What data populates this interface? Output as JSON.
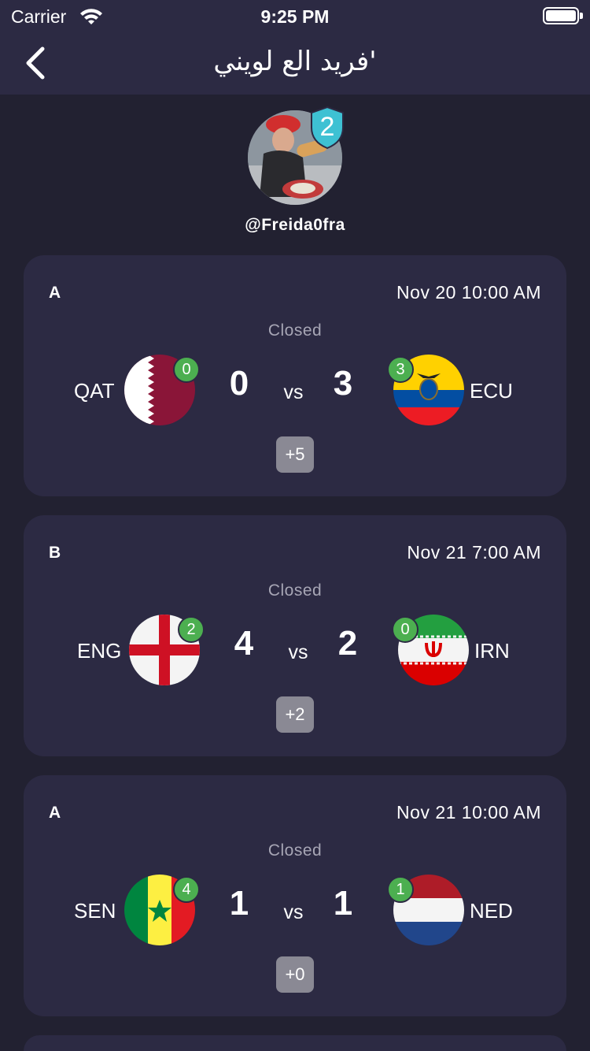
{
  "status_bar": {
    "carrier": "Carrier",
    "time": "9:25 PM"
  },
  "nav": {
    "title": "فريد الع لويني'",
    "back_icon": "chevron-left-icon"
  },
  "profile": {
    "rank": "2",
    "username": "@Freida0fra"
  },
  "colors": {
    "background": "#222131",
    "card": "#2c2a43",
    "badge_green": "#4caf50",
    "rank_badge": "#3ec1d3",
    "more_button": "#8a8994"
  },
  "matches": [
    {
      "group": "A",
      "date": "Nov 20 10:00 AM",
      "state": "Closed",
      "home": {
        "code": "QAT",
        "flag": "qatar-flag",
        "prediction": "0",
        "score": "0"
      },
      "vs": "vs",
      "away": {
        "code": "ECU",
        "flag": "ecuador-flag",
        "prediction": "3",
        "score": "3"
      },
      "more": "+5"
    },
    {
      "group": "B",
      "date": "Nov 21 7:00 AM",
      "state": "Closed",
      "home": {
        "code": "ENG",
        "flag": "england-flag",
        "prediction": "2",
        "score": "4"
      },
      "vs": "vs",
      "away": {
        "code": "IRN",
        "flag": "iran-flag",
        "prediction": "0",
        "score": "2"
      },
      "more": "+2"
    },
    {
      "group": "A",
      "date": "Nov 21 10:00 AM",
      "state": "Closed",
      "home": {
        "code": "SEN",
        "flag": "senegal-flag",
        "prediction": "4",
        "score": "1"
      },
      "vs": "vs",
      "away": {
        "code": "NED",
        "flag": "netherlands-flag",
        "prediction": "1",
        "score": "1"
      },
      "more": "+0"
    }
  ]
}
